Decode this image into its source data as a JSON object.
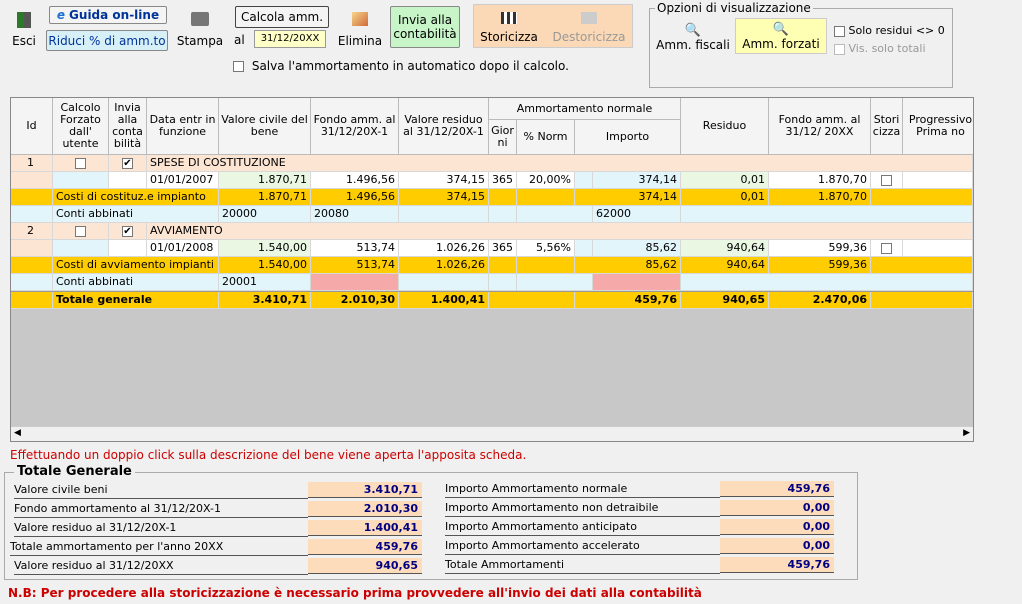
{
  "toolbar": {
    "esci": "Esci",
    "guida": "Guida on-line",
    "riduci": "Riduci % di amm.to",
    "stampa": "Stampa",
    "calcola": "Calcola amm.",
    "al": "al",
    "date": "31/12/20XX",
    "elimina": "Elimina",
    "invia": "Invia alla contabilità",
    "storicizza": "Storicizza",
    "destoricizza": "Destoricizza",
    "salva_auto": "Salva l'ammortamento in automatico dopo il calcolo."
  },
  "options": {
    "title": "Opzioni di visualizzazione",
    "amm_fiscali": "Amm. fiscali",
    "amm_forzati": "Amm. forzati",
    "solo_residui": "Solo residui <> 0",
    "vis_totali": "Vis. solo totali"
  },
  "grid": {
    "headers": {
      "id": "Id",
      "calcolo": "Calcolo Forzato dall' utente",
      "invia": "Invia alla conta bilità",
      "data": "Data entr in funzione",
      "valore": "Valore civile del bene",
      "fondo": "Fondo amm. al 31/12/20X-1",
      "residuo_val": "Valore residuo al 31/12/20X-1",
      "amm_normale": "Ammortamento normale",
      "giorni": "Gior ni",
      "perc": "% Norm",
      "importo": "Importo",
      "residuo": "Residuo",
      "fondo2": "Fondo amm. al 31/12/ 20XX",
      "stori": "Stori cizza",
      "progressivo": "Progressivo Prima no"
    },
    "items": [
      {
        "id": "1",
        "desc": "SPESE DI COSTITUZIONE",
        "check_invia": "✔",
        "data": "01/01/2007",
        "valore": "1.870,71",
        "fondo": "1.496,56",
        "res": "374,15",
        "giorni": "365",
        "perc": "20,00%",
        "importo": "374,14",
        "residuo": "0,01",
        "fondo2": "1.870,70",
        "cat": "Costi di costituz.e impianto",
        "cat_valore": "1.870,71",
        "cat_fondo": "1.496,56",
        "cat_res": "374,15",
        "cat_importo": "374,14",
        "cat_residuo": "0,01",
        "cat_fondo2": "1.870,70",
        "conti": "Conti abbinati",
        "c1": "20000",
        "c2": "20080",
        "c3": "62000"
      },
      {
        "id": "2",
        "desc": "AVVIAMENTO",
        "check_invia": "✔",
        "data": "01/01/2008",
        "valore": "1.540,00",
        "fondo": "513,74",
        "res": "1.026,26",
        "giorni": "365",
        "perc": "5,56%",
        "importo": "85,62",
        "residuo": "940,64",
        "fondo2": "599,36",
        "cat": "Costi di avviamento impianti",
        "cat_valore": "1.540,00",
        "cat_fondo": "513,74",
        "cat_res": "1.026,26",
        "cat_importo": "85,62",
        "cat_residuo": "940,64",
        "cat_fondo2": "599,36",
        "conti": "Conti abbinati",
        "c1": "20001"
      }
    ],
    "total": {
      "label": "Totale generale",
      "valore": "3.410,71",
      "fondo": "2.010,30",
      "res": "1.400,41",
      "importo": "459,76",
      "residuo": "940,65",
      "fondo2": "2.470,06"
    }
  },
  "hint": "Effettuando un doppio click sulla descrizione del bene viene aperta l'apposita scheda.",
  "summary": {
    "title": "Totale Generale",
    "left": [
      {
        "label": "Valore civile beni",
        "value": "3.410,71"
      },
      {
        "label": "Fondo ammortamento al 31/12/20X-1",
        "value": "2.010,30"
      },
      {
        "label": "Valore residuo al 31/12/20X-1",
        "value": "1.400,41"
      },
      {
        "label": "Totale ammortamento per l'anno 20XX",
        "value": "459,76"
      },
      {
        "label": "Valore residuo al 31/12/20XX",
        "value": "940,65"
      }
    ],
    "right": [
      {
        "label": "Importo Ammortamento normale",
        "value": "459,76"
      },
      {
        "label": "Importo Ammortamento non detraibile",
        "value": "0,00"
      },
      {
        "label": "Importo Ammortamento anticipato",
        "value": "0,00"
      },
      {
        "label": "Importo Ammortamento accelerato",
        "value": "0,00"
      },
      {
        "label": "Totale Ammortamenti",
        "value": "459,76"
      }
    ]
  },
  "note": "N.B: Per procedere alla storicizzazione è necessario prima provvedere all'invio dei dati alla contabilità"
}
